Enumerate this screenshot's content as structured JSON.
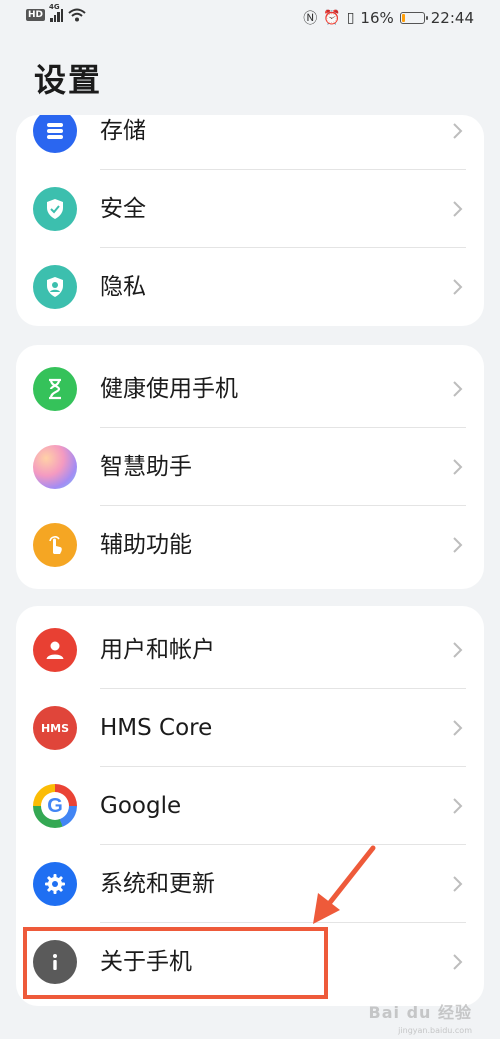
{
  "status_bar": {
    "hd": "HD",
    "net": "4G",
    "battery_percent": "16%",
    "battery_level": 0.16,
    "time": "22:44",
    "icons": [
      "hd-icon",
      "signal-icon",
      "wifi-icon",
      "nfc-icon",
      "alarm-icon",
      "vibrate-icon",
      "battery-icon"
    ]
  },
  "header": {
    "title": "设置"
  },
  "groups": [
    {
      "items": [
        {
          "label": "存储",
          "icon": "storage-icon",
          "color": "#2a66f0"
        },
        {
          "label": "安全",
          "icon": "shield-icon",
          "color": "#3cbfae"
        },
        {
          "label": "隐私",
          "icon": "privacy-icon",
          "color": "#3cbfae"
        }
      ]
    },
    {
      "items": [
        {
          "label": "健康使用手机",
          "icon": "hourglass-icon",
          "color": "#35c25a"
        },
        {
          "label": "智慧助手",
          "icon": "assistant-icon",
          "color": "#b98bf2"
        },
        {
          "label": "辅助功能",
          "icon": "accessibility-hand-icon",
          "color": "#f5a623"
        }
      ]
    },
    {
      "items": [
        {
          "label": "用户和帐户",
          "icon": "user-icon",
          "color": "#e84033"
        },
        {
          "label": "HMS Core",
          "icon": "hms-icon",
          "color": "#e0453a"
        },
        {
          "label": "Google",
          "icon": "google-icon",
          "color": "#4285f4"
        },
        {
          "label": "系统和更新",
          "icon": "gear-icon",
          "color": "#1f6ff2"
        },
        {
          "label": "关于手机",
          "icon": "info-icon",
          "color": "#5a5a5a"
        }
      ]
    }
  ],
  "icon_text": {
    "hms": "HMS"
  },
  "annotation": {
    "color": "#ee5a3a",
    "target": "关于手机"
  },
  "watermark": {
    "text": "Bai du 经验",
    "sub": "jingyan.baidu.com"
  }
}
